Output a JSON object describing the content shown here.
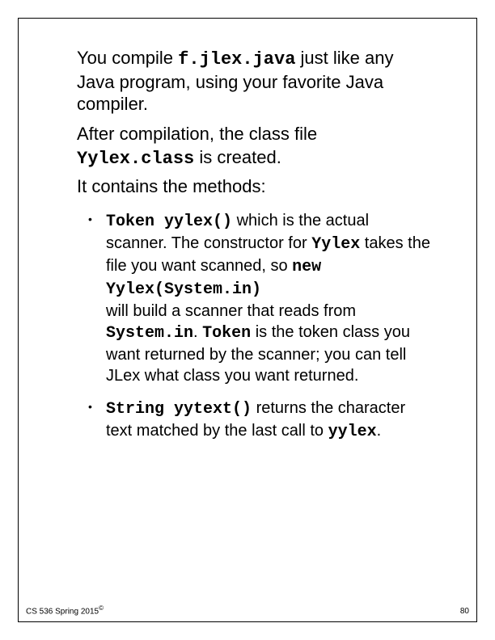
{
  "para1": {
    "t1": "You compile ",
    "code1": "f.jlex.java",
    "t2": " just like any Java program, using your favorite Java compiler."
  },
  "para2": {
    "t1": "After compilation, the class file ",
    "code1": "Yylex.class",
    "t2": " is created."
  },
  "para3": {
    "t1": "It contains the methods:"
  },
  "bullet1": {
    "code1": "Token yylex()",
    "t1": " which is the actual scanner. The constructor for ",
    "code2": "Yylex",
    "t2": " takes the file you want scanned, so ",
    "code3": "new Yylex(System.in)",
    "t3": " will build a scanner that reads from ",
    "code4": "System.in",
    "t4": ". ",
    "code5": "Token",
    "t5": " is the token class you want returned by the scanner; you can tell JLex what class you want returned."
  },
  "bullet2": {
    "code1": "String yytext()",
    "t1": " returns the character text matched by the last call to ",
    "code2": "yylex",
    "t2": "."
  },
  "footer": {
    "left": "CS 536  Spring 2015",
    "copy": "©",
    "right": "80"
  }
}
